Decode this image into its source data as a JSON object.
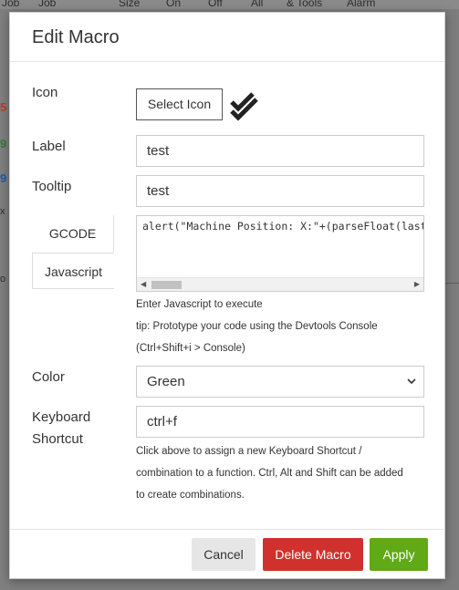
{
  "background": {
    "header_labels": [
      "Job",
      "Job",
      "Size",
      "On",
      "Off",
      "All",
      "& Tools",
      "Alarm"
    ],
    "left_marks": [
      {
        "text": "5",
        "color": "#c0392b"
      },
      {
        "text": "9",
        "color": "#2e7d32"
      },
      {
        "text": "9",
        "color": "#1e5aa8"
      },
      {
        "text": "x",
        "color": "#2e2e2e"
      },
      {
        "text": "o",
        "color": "#2e2e2e"
      }
    ]
  },
  "modal": {
    "title": "Edit Macro",
    "icon": {
      "label": "Icon",
      "button_label": "Select Icon",
      "selected_icon": "double-check-icon"
    },
    "label_field": {
      "label": "Label",
      "value": "test"
    },
    "tooltip_field": {
      "label": "Tooltip",
      "value": "test"
    },
    "tabs": [
      {
        "label": "GCODE",
        "active": false
      },
      {
        "label": "Javascript",
        "active": true
      }
    ],
    "code": {
      "value": "alert(\"Machine Position: X:\"+(parseFloat(laststatus.machine.position.work.x)))",
      "help_lines": [
        "Enter Javascript to execute",
        "tip: Prototype your code using the Devtools Console",
        "(Ctrl+Shift+i > Console)"
      ]
    },
    "color_field": {
      "label": "Color",
      "selected": "Green"
    },
    "shortcut_field": {
      "label_line1": "Keyboard",
      "label_line2": "Shortcut",
      "value": "ctrl+f",
      "help_lines": [
        "Click above to assign a new Keyboard Shortcut /",
        "combination to a function. Ctrl, Alt and Shift can be added",
        "to create combinations."
      ]
    },
    "buttons": {
      "cancel": "Cancel",
      "delete": "Delete Macro",
      "apply": "Apply"
    },
    "colors": {
      "delete": "#d0312d",
      "apply": "#60a917",
      "cancel_bg": "#e6e6e6"
    }
  }
}
